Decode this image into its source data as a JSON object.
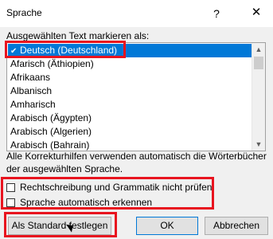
{
  "window": {
    "title": "Sprache",
    "help_glyph": "?",
    "close_glyph": "✕"
  },
  "language_section": {
    "label": "Ausgewählten Text markieren als:",
    "items": [
      {
        "label": "Deutsch (Deutschland)",
        "selected": true,
        "icon": "spellcheck-icon"
      },
      {
        "label": "Afarisch (Äthiopien)"
      },
      {
        "label": "Afrikaans"
      },
      {
        "label": "Albanisch"
      },
      {
        "label": "Amharisch"
      },
      {
        "label": "Arabisch (Ägypten)"
      },
      {
        "label": "Arabisch (Algerien)"
      },
      {
        "label": "Arabisch (Bahrain)"
      }
    ]
  },
  "info_text": "Alle Korrekturhilfen verwenden automatisch die Wörterbücher der ausgewählten Sprache.",
  "options": {
    "no_proofing": {
      "label": "Rechtschreibung und Grammatik nicht prüfen",
      "checked": false
    },
    "auto_detect": {
      "label": "Sprache automatisch erkennen",
      "checked": false
    }
  },
  "buttons": {
    "set_default": "Als Standard festlegen",
    "ok": "OK",
    "cancel": "Abbrechen"
  },
  "colors": {
    "highlight": "#e8141f",
    "selection": "#0078d7"
  }
}
